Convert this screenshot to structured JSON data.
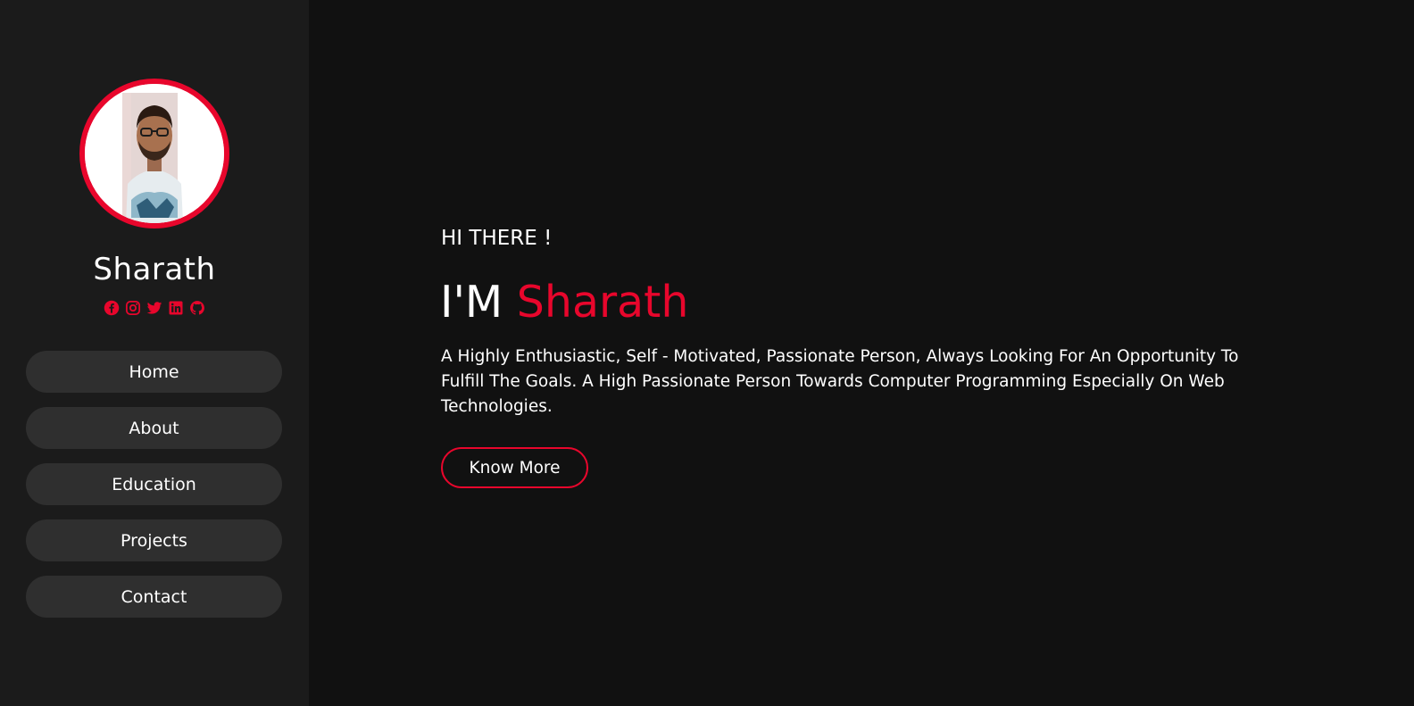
{
  "sidebar": {
    "profile_name": "Sharath",
    "socials": [
      {
        "icon": "facebook-icon"
      },
      {
        "icon": "instagram-icon"
      },
      {
        "icon": "twitter-icon"
      },
      {
        "icon": "linkedin-icon"
      },
      {
        "icon": "github-icon"
      }
    ],
    "nav": [
      {
        "label": "Home"
      },
      {
        "label": "About"
      },
      {
        "label": "Education"
      },
      {
        "label": "Projects"
      },
      {
        "label": "Contact"
      }
    ]
  },
  "hero": {
    "greeting": "HI THERE !",
    "headline_prefix": "I'M",
    "headline_name": "Sharath",
    "description": "A Highly Enthusiastic, Self - Motivated, Passionate Person, Always Looking For An Opportunity To Fulfill The Goals. A High Passionate Person Towards Computer Programming Especially On Web Technologies.",
    "cta_label": "Know More"
  },
  "colors": {
    "accent": "#e8062c",
    "sidebar_bg": "#1b1b1b",
    "main_bg": "#111111",
    "nav_item_bg": "#2f2f2f",
    "text": "#ffffff"
  }
}
